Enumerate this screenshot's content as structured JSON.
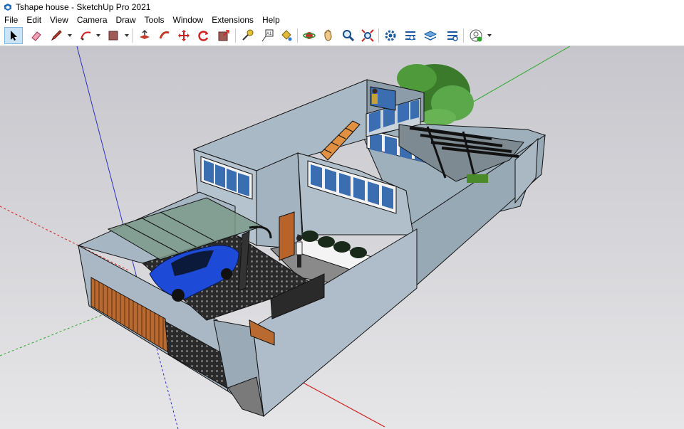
{
  "window": {
    "title": "Tshape house - SketchUp Pro 2021"
  },
  "menu": {
    "items": [
      "File",
      "Edit",
      "View",
      "Camera",
      "Draw",
      "Tools",
      "Window",
      "Extensions",
      "Help"
    ]
  },
  "toolbar": {
    "tools": [
      "select",
      "eraser",
      "line",
      "arc",
      "rectangle",
      "push-pull",
      "follow-me",
      "move",
      "rotate",
      "scale",
      "tape-measure",
      "text",
      "paint-bucket",
      "orbit",
      "pan",
      "zoom",
      "zoom-extents",
      "model-info",
      "components",
      "layers",
      "styles",
      "account"
    ]
  },
  "colors": {
    "sky": "#c9c9cf",
    "wall": "#a6b6c3",
    "axis_blue": "#2f2fbf",
    "axis_green": "#2aa82a",
    "axis_red": "#d02020"
  }
}
